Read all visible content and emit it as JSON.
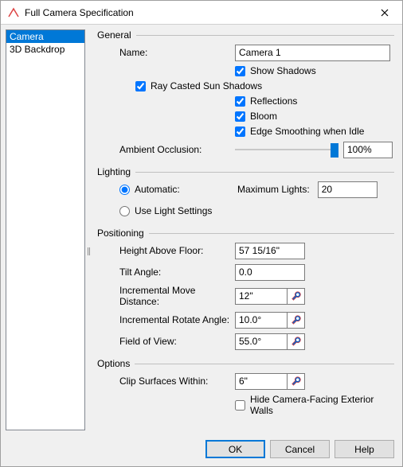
{
  "window": {
    "title": "Full Camera Specification"
  },
  "sidebar": {
    "items": [
      {
        "label": "Camera",
        "selected": true
      },
      {
        "label": "3D Backdrop",
        "selected": false
      }
    ]
  },
  "general": {
    "title": "General",
    "name_label": "Name:",
    "name_value": "Camera 1",
    "show_shadows_label": "Show Shadows",
    "show_shadows_checked": true,
    "ray_casted_label": "Ray Casted Sun Shadows",
    "ray_casted_checked": true,
    "reflections_label": "Reflections",
    "reflections_checked": true,
    "bloom_label": "Bloom",
    "bloom_checked": true,
    "edge_smoothing_label": "Edge Smoothing when Idle",
    "edge_smoothing_checked": true,
    "ambient_occlusion_label": "Ambient Occlusion:",
    "ambient_occlusion_value": "100%",
    "ambient_occlusion_pct": 100
  },
  "lighting": {
    "title": "Lighting",
    "automatic_label": "Automatic:",
    "automatic_selected": true,
    "use_light_settings_label": "Use Light Settings",
    "use_light_settings_selected": false,
    "max_lights_label": "Maximum Lights:",
    "max_lights_value": "20"
  },
  "positioning": {
    "title": "Positioning",
    "height_label": "Height Above Floor:",
    "height_value": "57 15/16\"",
    "tilt_label": "Tilt Angle:",
    "tilt_value": "0.0",
    "move_dist_label": "Incremental Move Distance:",
    "move_dist_value": "12\"",
    "rotate_angle_label": "Incremental Rotate Angle:",
    "rotate_angle_value": "10.0°",
    "fov_label": "Field of View:",
    "fov_value": "55.0°"
  },
  "options": {
    "title": "Options",
    "clip_label": "Clip Surfaces Within:",
    "clip_value": "6\"",
    "hide_walls_label": "Hide Camera-Facing Exterior Walls",
    "hide_walls_checked": false
  },
  "buttons": {
    "ok": "OK",
    "cancel": "Cancel",
    "help": "Help"
  }
}
